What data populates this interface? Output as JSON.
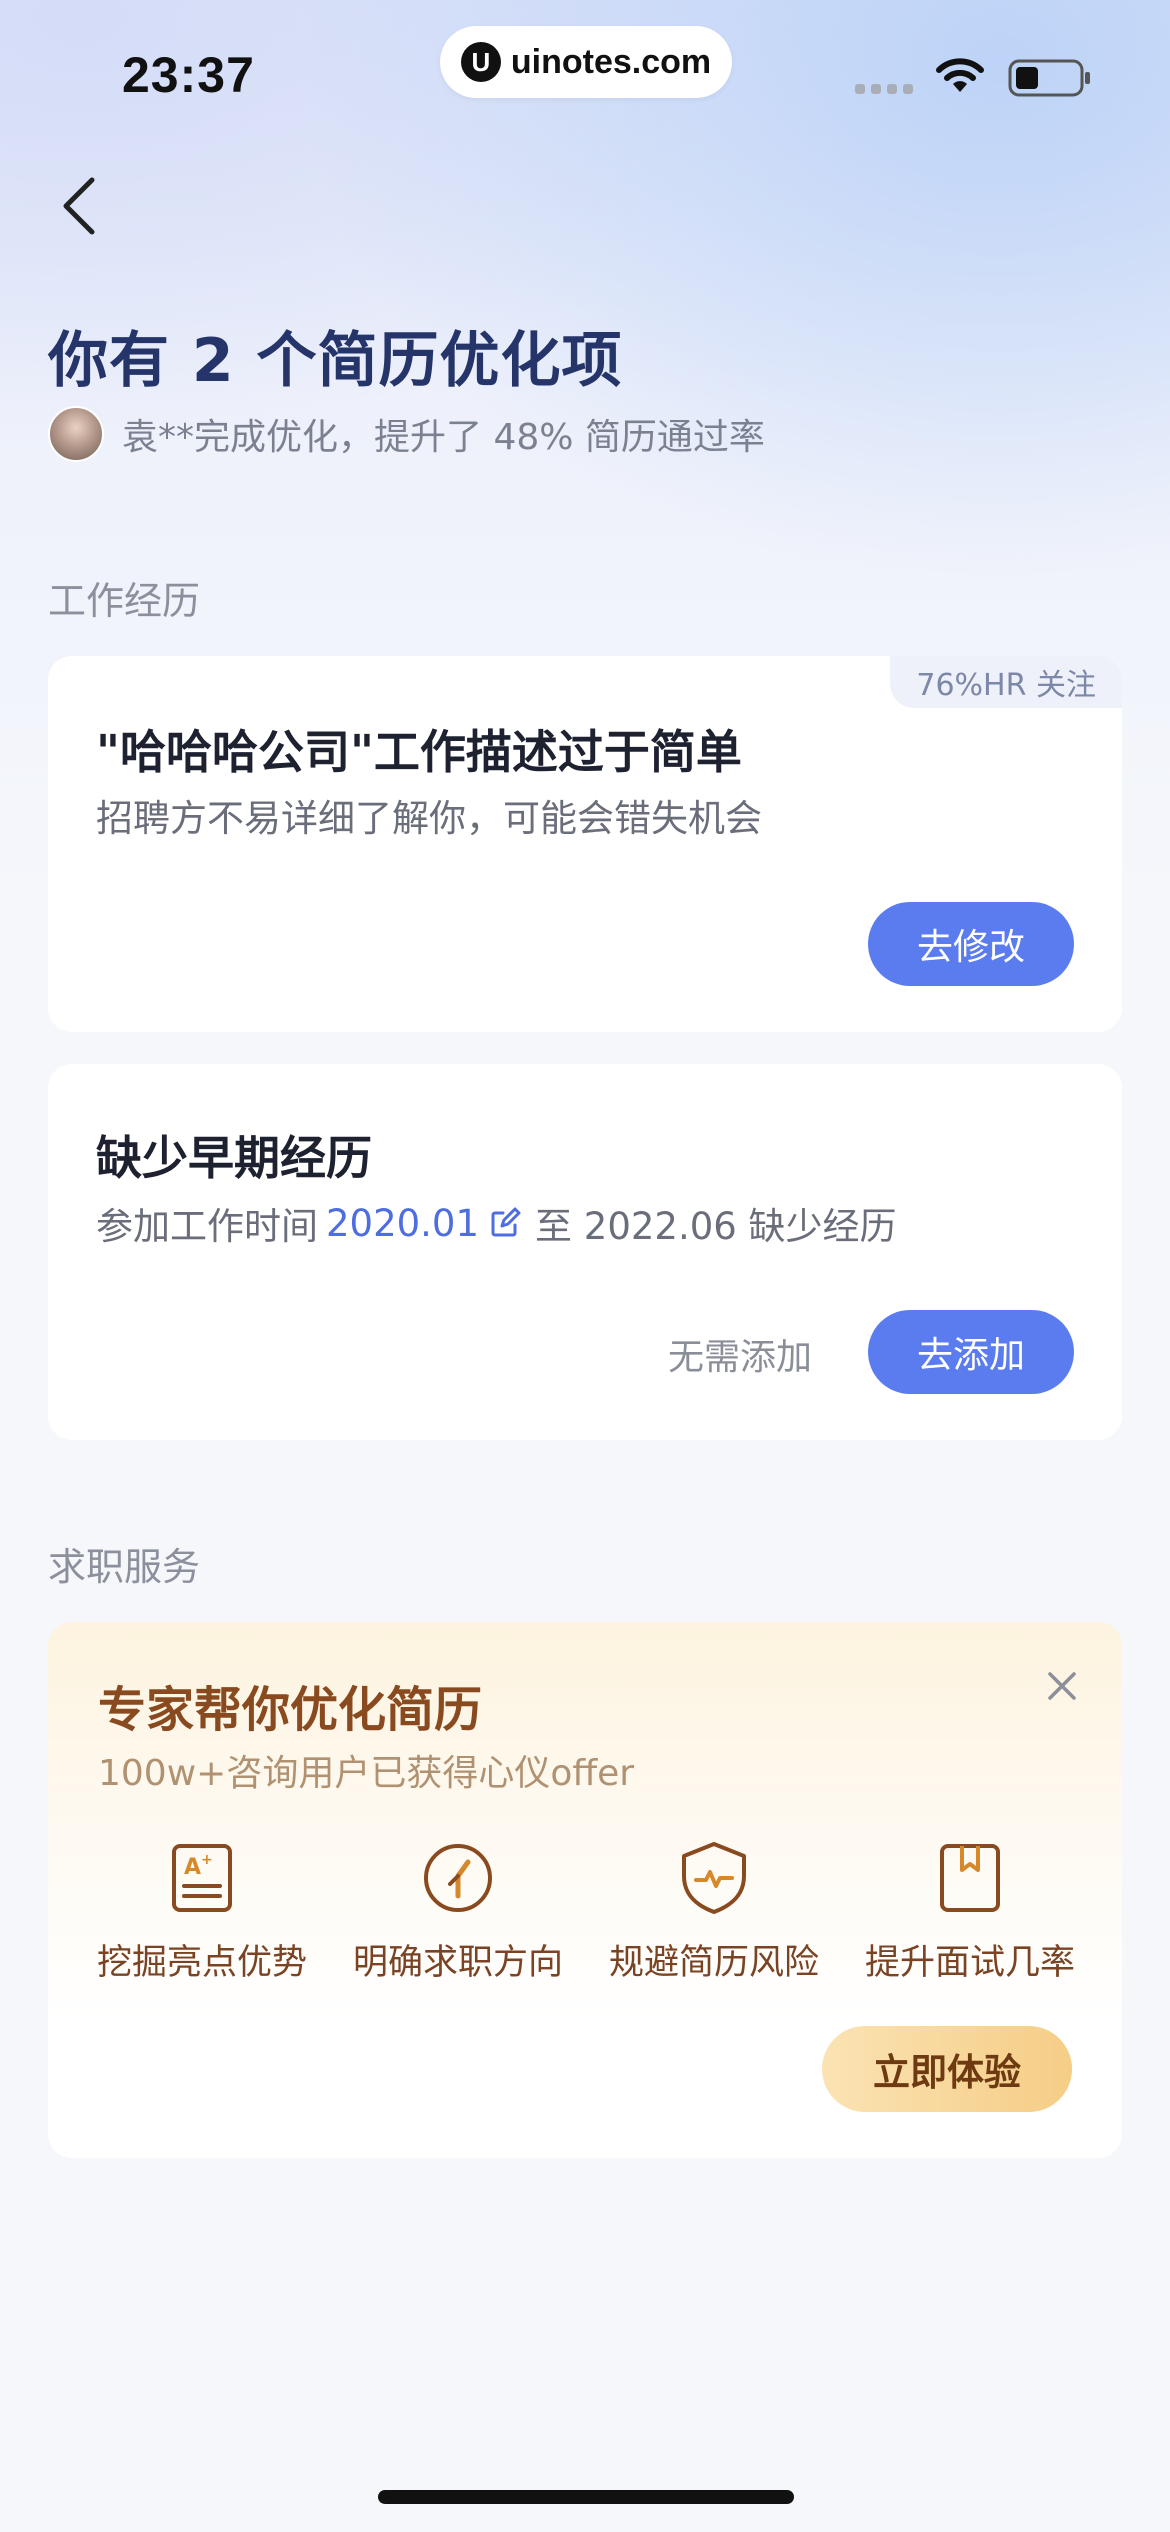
{
  "status_bar": {
    "time": "23:37",
    "url": "uinotes.com",
    "url_logo": "U"
  },
  "header": {
    "title": "你有 2 个简历优化项",
    "subtitle": "袁**完成优化，提升了 48% 简历通过率"
  },
  "work_section": {
    "label": "工作经历",
    "card1": {
      "badge": "76%HR 关注",
      "title": "\"哈哈哈公司\"工作描述过于简单",
      "desc": "招聘方不易详细了解你，可能会错失机会",
      "button": "去修改"
    },
    "card2": {
      "title": "缺少早期经历",
      "desc_prefix": "参加工作时间",
      "start_date": "2020.01",
      "desc_suffix": "至 2022.06 缺少经历",
      "skip_button": "无需添加",
      "add_button": "去添加"
    }
  },
  "service_section": {
    "label": "求职服务",
    "card": {
      "title": "专家帮你优化简历",
      "subtitle": "100w+咨询用户已获得心仪offer",
      "features": [
        {
          "label": "挖掘亮点优势",
          "icon": "resume-star-icon"
        },
        {
          "label": "明确求职方向",
          "icon": "compass-icon"
        },
        {
          "label": "规避简历风险",
          "icon": "shield-icon"
        },
        {
          "label": "提升面试几率",
          "icon": "bookmark-icon"
        }
      ],
      "button": "立即体验"
    }
  },
  "colors": {
    "primary": "#5b7cef",
    "title_navy": "#253469",
    "service_brown": "#8a4a1f",
    "gold_button": "#f5cd86"
  }
}
